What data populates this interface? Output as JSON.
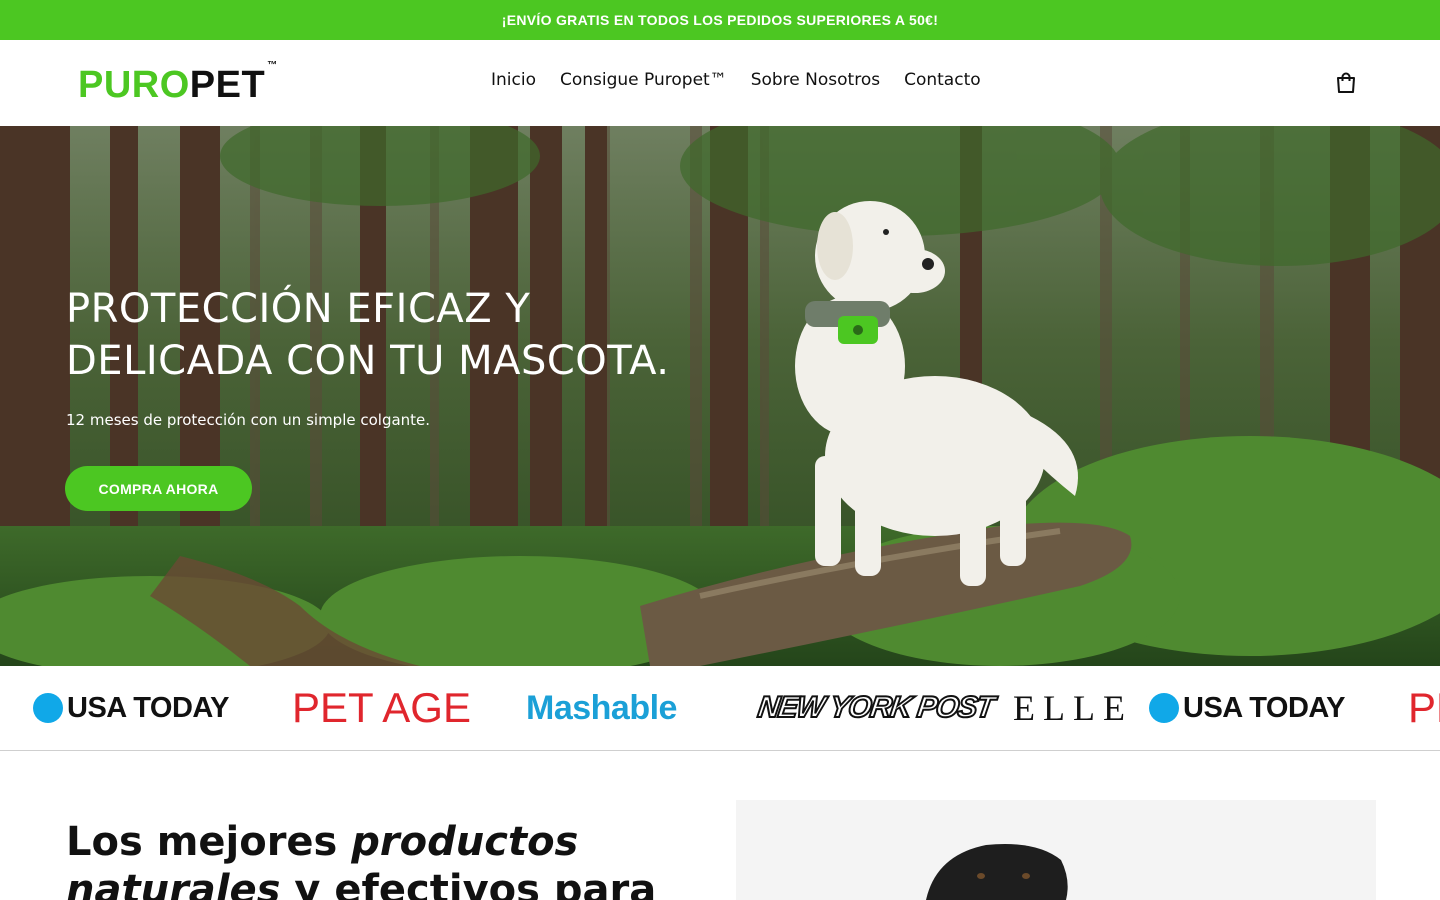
{
  "announcement": {
    "text": "¡ENVÍO GRATIS EN TODOS LOS PEDIDOS SUPERIORES A 50€!"
  },
  "brand": {
    "name_part1": "PURO",
    "name_part2": "PET",
    "trademark": "™",
    "accent_color": "#4cc722"
  },
  "nav": {
    "items": [
      {
        "label": "Inicio"
      },
      {
        "label": "Consigue Puropet™"
      },
      {
        "label": "Sobre Nosotros"
      },
      {
        "label": "Contacto"
      }
    ],
    "cart_icon": "shopping-bag-icon"
  },
  "hero": {
    "title_line1": "PROTECCIÓN EFICAZ Y",
    "title_line2": "DELICADA CON TU MASCOTA.",
    "subtitle": "12 meses de protección con un simple colgante.",
    "cta_label": "COMPRA AHORA"
  },
  "press": {
    "logos": [
      {
        "name": "USA TODAY"
      },
      {
        "name": "PET AGE"
      },
      {
        "name": "Mashable"
      },
      {
        "name": "NEW YORK POST"
      },
      {
        "name": "ELLE"
      },
      {
        "name": "USA TODAY"
      },
      {
        "name": "PE"
      }
    ]
  },
  "intro": {
    "text_regular1": "Los mejores ",
    "text_bold1": "productos",
    "text_bold2": "naturales",
    "text_regular2": " y efectivos para"
  }
}
